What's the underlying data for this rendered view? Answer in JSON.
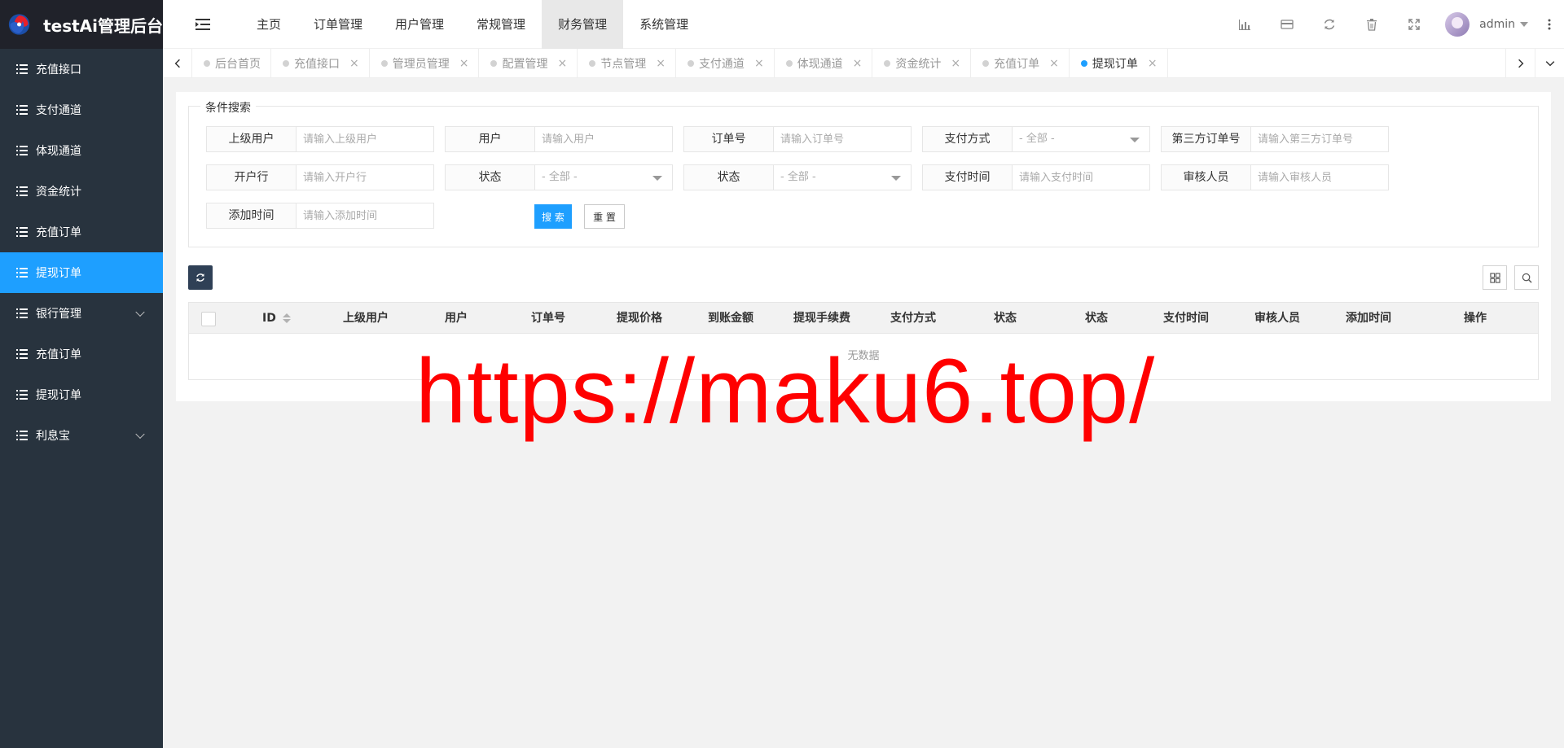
{
  "app": {
    "title": "testAi管理后台"
  },
  "sidebar": {
    "items": [
      {
        "label": "充值接口"
      },
      {
        "label": "支付通道"
      },
      {
        "label": "体现通道"
      },
      {
        "label": "资金统计"
      },
      {
        "label": "充值订单"
      },
      {
        "label": "提现订单",
        "active": true
      },
      {
        "label": "银行管理",
        "expandable": true
      },
      {
        "label": "充值订单"
      },
      {
        "label": "提现订单"
      },
      {
        "label": "利息宝",
        "expandable": true
      }
    ]
  },
  "header": {
    "nav": [
      {
        "label": "主页"
      },
      {
        "label": "订单管理"
      },
      {
        "label": "用户管理"
      },
      {
        "label": "常规管理"
      },
      {
        "label": "财务管理",
        "active": true
      },
      {
        "label": "系统管理"
      }
    ],
    "user": {
      "name": "admin"
    }
  },
  "tabs": [
    {
      "label": "后台首页",
      "closable": false
    },
    {
      "label": "充值接口",
      "closable": true
    },
    {
      "label": "管理员管理",
      "closable": true
    },
    {
      "label": "配置管理",
      "closable": true
    },
    {
      "label": "节点管理",
      "closable": true
    },
    {
      "label": "支付通道",
      "closable": true
    },
    {
      "label": "体现通道",
      "closable": true
    },
    {
      "label": "资金统计",
      "closable": true
    },
    {
      "label": "充值订单",
      "closable": true
    },
    {
      "label": "提现订单",
      "closable": true,
      "active": true
    }
  ],
  "search": {
    "legend": "条件搜索",
    "fields": {
      "parent_user": {
        "label": "上级用户",
        "placeholder": "请输入上级用户"
      },
      "user": {
        "label": "用户",
        "placeholder": "请输入用户"
      },
      "order_no": {
        "label": "订单号",
        "placeholder": "请输入订单号"
      },
      "pay_method": {
        "label": "支付方式",
        "value": "- 全部 -"
      },
      "third_order_no": {
        "label": "第三方订单号",
        "placeholder": "请输入第三方订单号"
      },
      "bank": {
        "label": "开户行",
        "placeholder": "请输入开户行"
      },
      "status1": {
        "label": "状态",
        "value": "- 全部 -"
      },
      "status2": {
        "label": "状态",
        "value": "- 全部 -"
      },
      "pay_time": {
        "label": "支付时间",
        "placeholder": "请输入支付时间"
      },
      "reviewer": {
        "label": "审核人员",
        "placeholder": "请输入审核人员"
      },
      "add_time": {
        "label": "添加时间",
        "placeholder": "请输入添加时间"
      }
    },
    "search_label": "搜 索",
    "reset_label": "重 置"
  },
  "table": {
    "columns": [
      "ID",
      "上级用户",
      "用户",
      "订单号",
      "提现价格",
      "到账金额",
      "提现手续费",
      "支付方式",
      "状态",
      "状态",
      "支付时间",
      "审核人员",
      "添加时间",
      "操作"
    ],
    "empty_text": "无数据"
  },
  "watermark": "https://maku6.top/",
  "colors": {
    "accent": "#1e9fff",
    "sidebar": "#28333e",
    "watermark": "#ff0000"
  }
}
